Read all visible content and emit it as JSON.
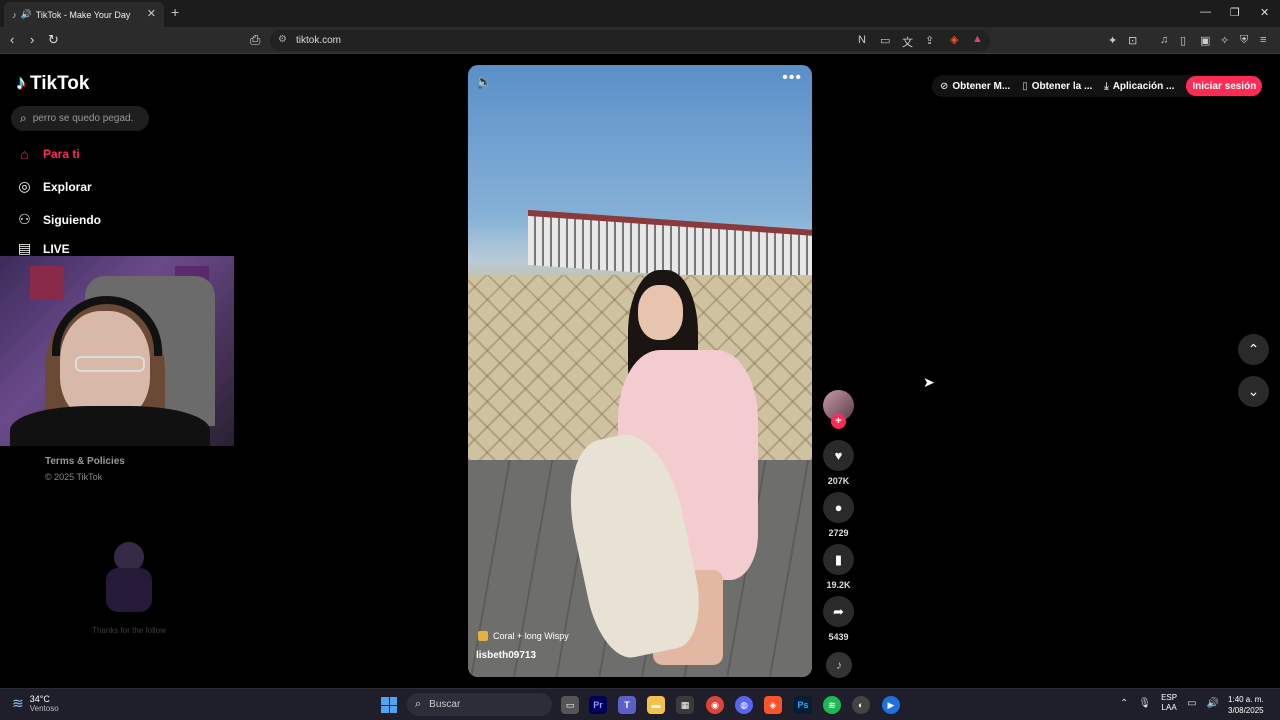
{
  "browser": {
    "tab_title": "TikTok - Make Your Day",
    "tab_audio_icon": "speaker-icon",
    "url": "tiktok.com",
    "window_controls": [
      "minimize-icon",
      "restore-icon",
      "close-icon"
    ]
  },
  "tiktok": {
    "logo_text": "TikTok",
    "search_placeholder": "perro se quedo pegad...",
    "nav": [
      {
        "label": "Para ti",
        "icon": "home-icon",
        "active": true
      },
      {
        "label": "Explorar",
        "icon": "compass-icon"
      },
      {
        "label": "Siguiendo",
        "icon": "following-icon"
      },
      {
        "label": "LIVE",
        "icon": "live-icon"
      }
    ],
    "footer": {
      "terms": "Terms & Policies",
      "copyright": "© 2025 TikTok"
    },
    "overlay_caption": "Thanks for the follow",
    "header": {
      "get_coins": "Obtener M...",
      "get_app": "Obtener la ...",
      "app_download": "Aplicación ...",
      "login": "Iniciar sesión"
    },
    "video": {
      "music": "Coral + long Wispy",
      "username": "lisbeth09713"
    },
    "actions": {
      "likes": "207K",
      "comments": "2729",
      "saves": "19.2K",
      "shares": "5439"
    },
    "colors": {
      "accent": "#fe2c55"
    }
  },
  "taskbar": {
    "temperature": "34°C",
    "weather_desc": "Ventoso",
    "search_placeholder": "Buscar",
    "lang_line1": "ESP",
    "lang_line2": "LAA",
    "time": "1:40 a. m.",
    "date": "3/08/2025"
  }
}
